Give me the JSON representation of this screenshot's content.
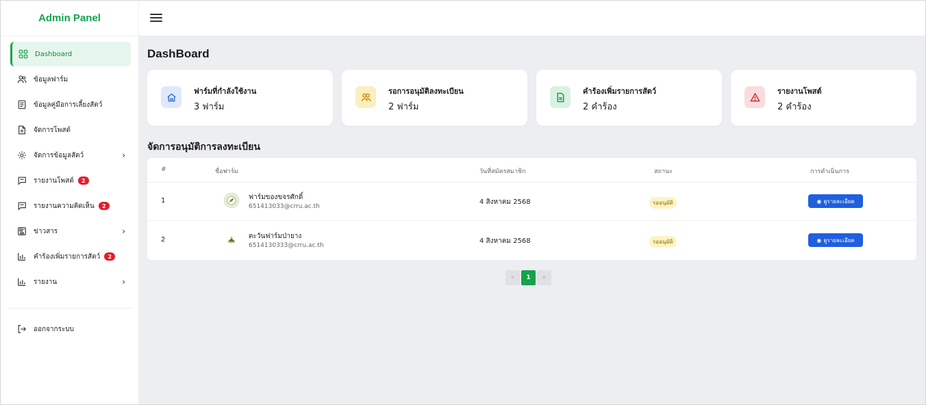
{
  "brand": "Admin Panel",
  "sidebar": {
    "items": [
      {
        "label": "Dashboard",
        "icon": "dashboard-grid-icon",
        "active": true
      },
      {
        "label": "ข้อมูลฟาร์ม",
        "icon": "users-icon"
      },
      {
        "label": "ข้อมูลคู่มือการเลี้ยงสัตว์",
        "icon": "book-icon"
      },
      {
        "label": "จัดการโพสต์",
        "icon": "file-icon"
      },
      {
        "label": "จัดการข้อมูลสัตว์",
        "icon": "gear-icon",
        "chevron": "›"
      },
      {
        "label": "รายงานโพสต์",
        "icon": "message-icon",
        "badge": "2"
      },
      {
        "label": "รายงานความคิดเห็น",
        "icon": "message-icon",
        "badge": "2"
      },
      {
        "label": "ข่าวสาร",
        "icon": "news-icon",
        "chevron": "›"
      },
      {
        "label": "คำร้องเพิ่มรายการสัตว์",
        "icon": "bar-chart-icon",
        "badge": "2"
      },
      {
        "label": "รายงาน",
        "icon": "bar-chart-icon",
        "chevron": "›"
      }
    ],
    "logout": "ออกจากระบบ"
  },
  "page_title": "DashBoard",
  "cards": [
    {
      "title": "ฟาร์มที่กำลังใช้งาน",
      "value": "3 ฟาร์ม",
      "icon": "home-icon",
      "color": "#2f6fe0",
      "bg": "#dfe9fb"
    },
    {
      "title": "รอการอนุมัติลงทะเบียน",
      "value": "2 ฟาร์ม",
      "icon": "users-icon",
      "color": "#c98a06",
      "bg": "#fbefbf"
    },
    {
      "title": "คำร้องเพิ่มรายการสัตว์",
      "value": "2 คำร้อง",
      "icon": "file-icon",
      "color": "#15944a",
      "bg": "#d9f2e2"
    },
    {
      "title": "รายงานโพสต์",
      "value": "2 คำร้อง",
      "icon": "alert-triangle-icon",
      "color": "#d9202f",
      "bg": "#fbdcde"
    }
  ],
  "section_title": "จัดการอนุมัติการลงทะเบียน",
  "table": {
    "headers": [
      "#",
      "ชื่อฟาร์ม",
      "วันที่สมัครสมาชิก",
      "สถานะ",
      "การดำเนินการ"
    ],
    "rows": [
      {
        "no": "1",
        "name": "ฟาร์มของขจรศักดิ์",
        "email": "651413033@crru.ac.th",
        "date": "4 สิงหาคม 2568",
        "status": "รออนุมัติ",
        "action": "ดูรายละเอียด"
      },
      {
        "no": "2",
        "name": "ตะวันฟาร์มป่ายาง",
        "email": "6514130333@crru.ac.th",
        "date": "4 สิงหาคม 2568",
        "status": "รออนุมัติ",
        "action": "ดูรายละเอียด"
      }
    ]
  },
  "pagination": {
    "prev": "«",
    "current": "1",
    "next": "»"
  }
}
